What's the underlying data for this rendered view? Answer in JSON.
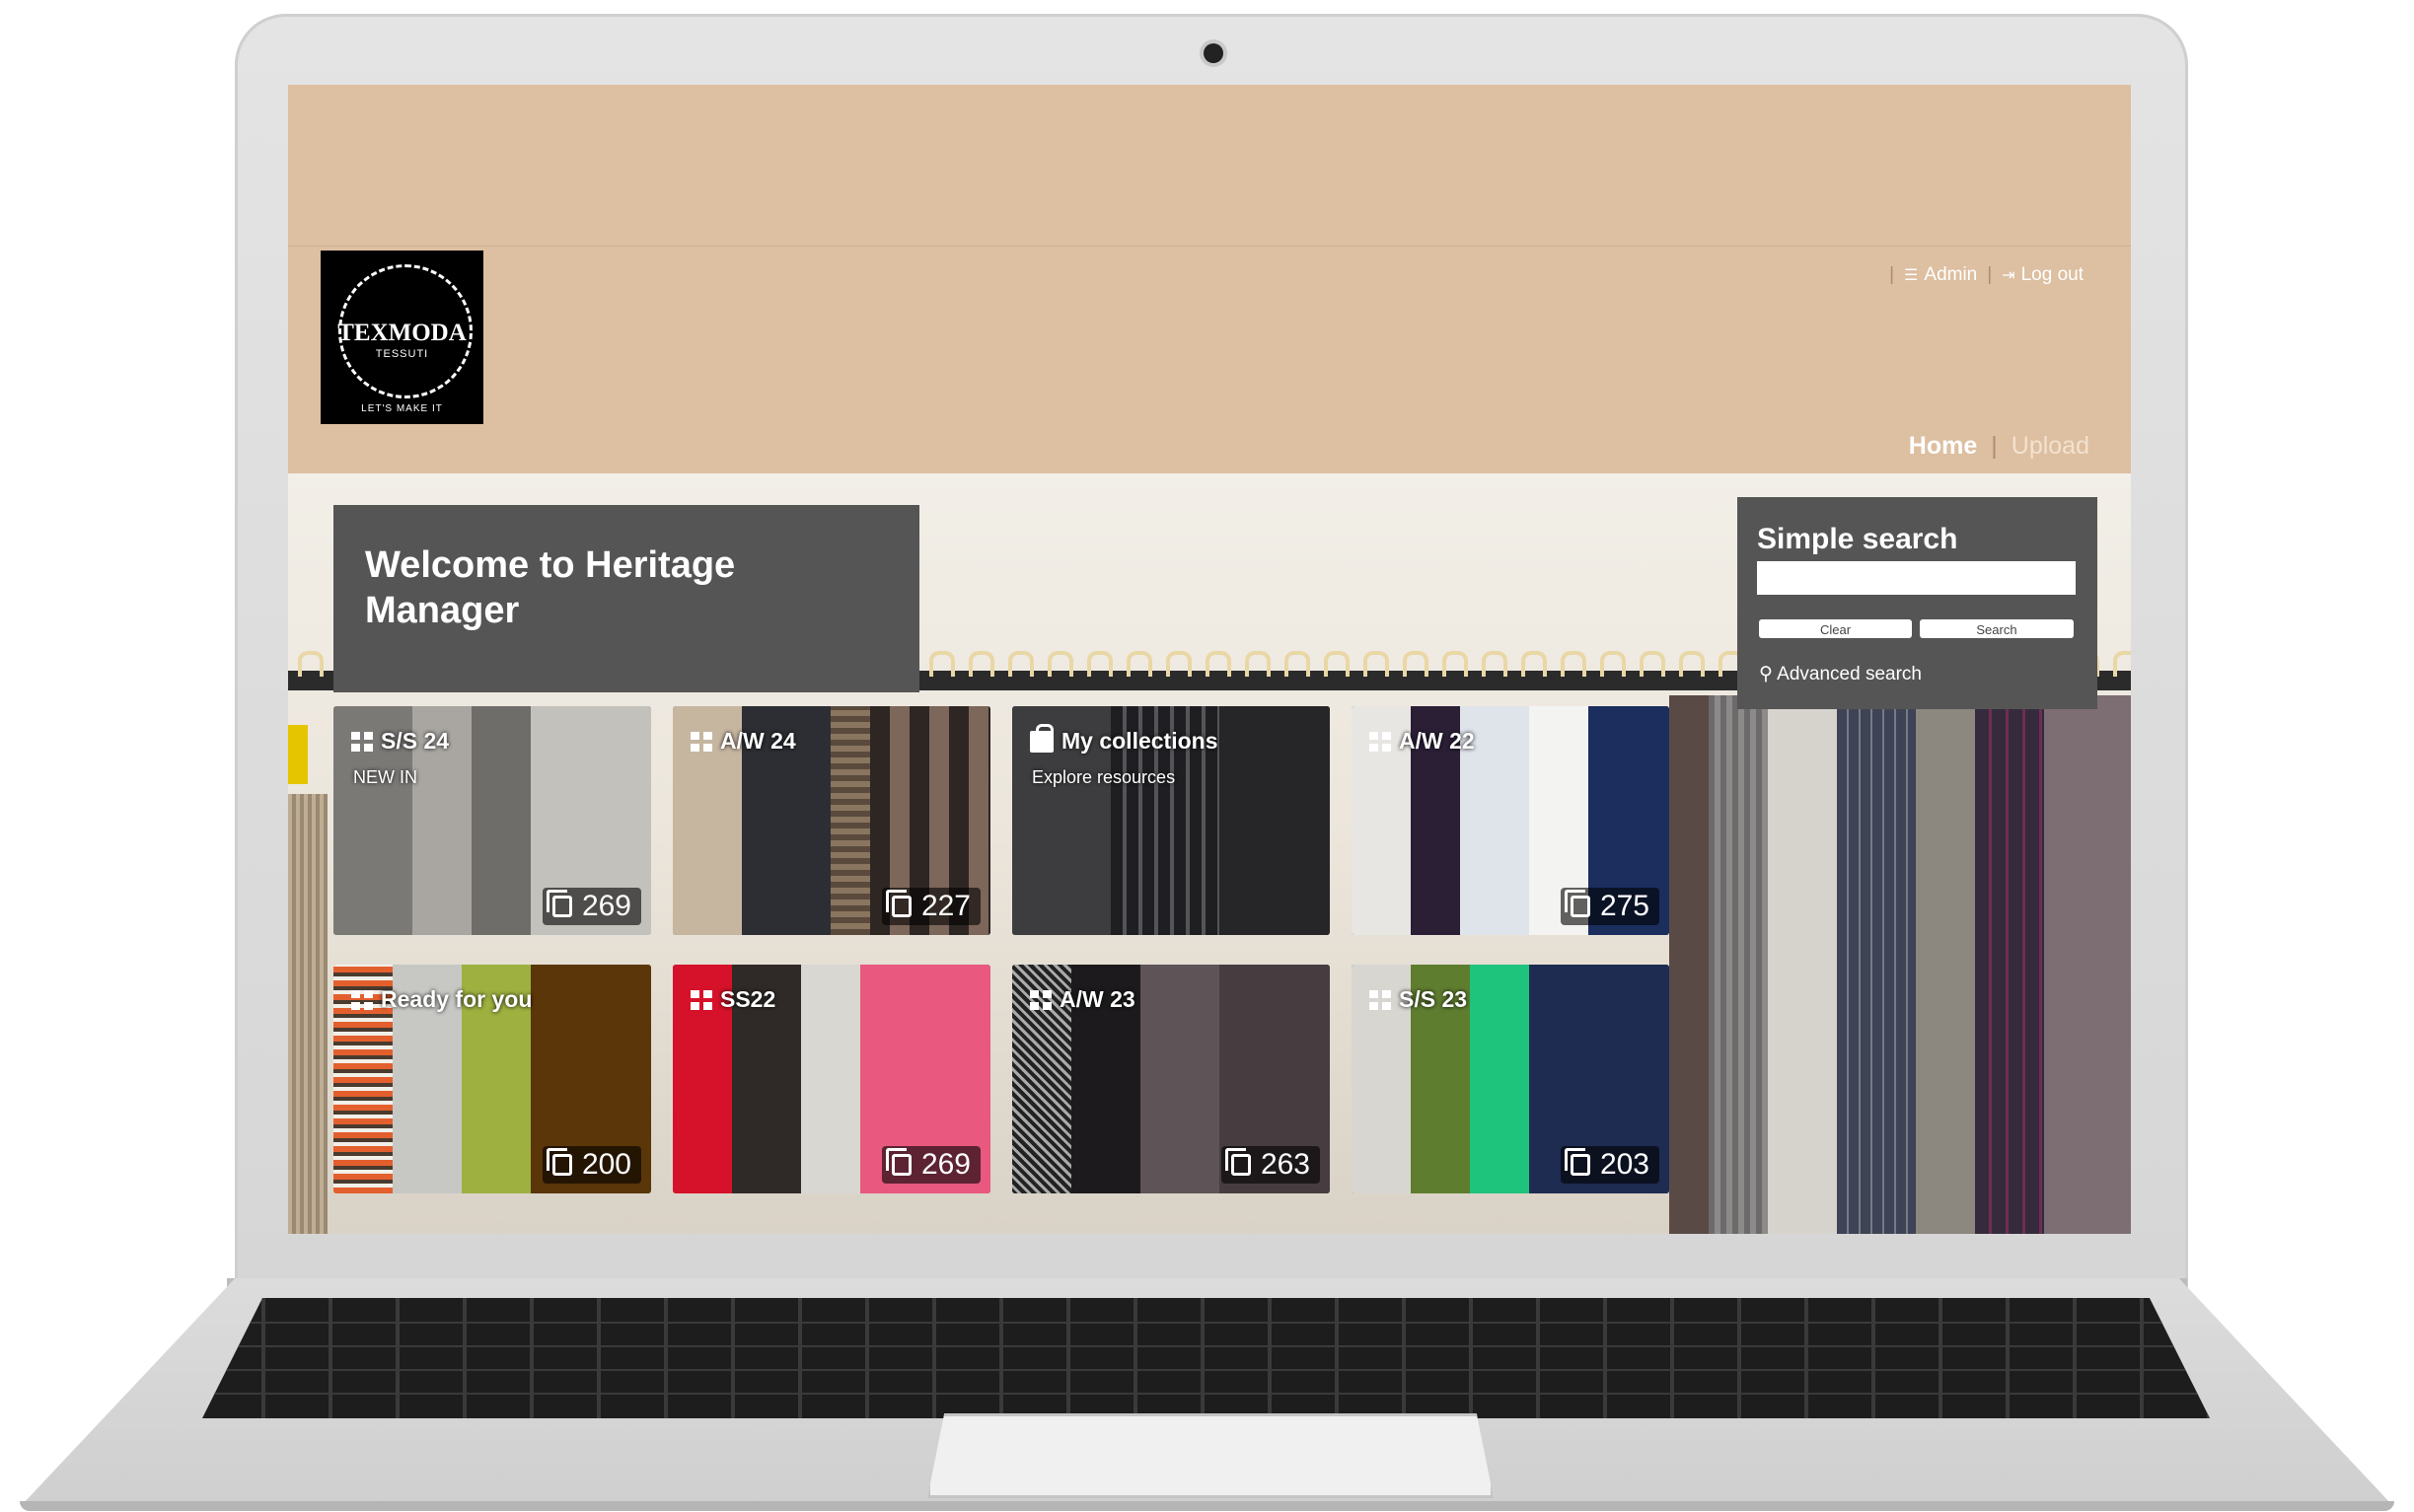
{
  "logo": {
    "name": "TEXMODA",
    "sub": "TESSUTI",
    "tagline": "LET'S MAKE IT"
  },
  "utility": {
    "admin": "Admin",
    "logout": "Log out"
  },
  "nav": {
    "home": "Home",
    "upload": "Upload"
  },
  "welcome": {
    "title": "Welcome to Heritage Manager"
  },
  "search": {
    "title": "Simple search",
    "input_value": "",
    "clear": "Clear",
    "search": "Search",
    "advanced": "Advanced search"
  },
  "tiles": [
    {
      "title": "S/S 24",
      "subtitle": "NEW IN",
      "count": "269",
      "icon": "grid-icon"
    },
    {
      "title": "A/W 24",
      "subtitle": "",
      "count": "227",
      "icon": "grid-icon"
    },
    {
      "title": "My collections",
      "subtitle": "Explore resources",
      "count": "",
      "icon": "bag-icon"
    },
    {
      "title": "A/W 22",
      "subtitle": "",
      "count": "275",
      "icon": "grid-icon"
    },
    {
      "title": "Ready for you",
      "subtitle": "",
      "count": "200",
      "icon": "grid-icon"
    },
    {
      "title": "SS22",
      "subtitle": "",
      "count": "269",
      "icon": "grid-icon"
    },
    {
      "title": "A/W 23",
      "subtitle": "",
      "count": "263",
      "icon": "grid-icon"
    },
    {
      "title": "S/S 23",
      "subtitle": "",
      "count": "203",
      "icon": "grid-icon"
    }
  ],
  "colors": {
    "header": "#ddbfa1",
    "panel": "#555555",
    "accent_text": "#ffffff"
  }
}
